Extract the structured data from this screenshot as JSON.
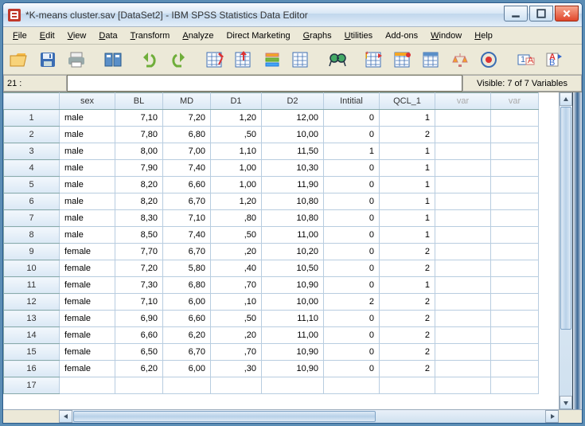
{
  "window": {
    "title": "*K-means cluster.sav [DataSet2] - IBM SPSS Statistics Data Editor"
  },
  "menu": {
    "file": "File",
    "edit": "Edit",
    "view": "View",
    "data": "Data",
    "transform": "Transform",
    "analyze": "Analyze",
    "direct": "Direct Marketing",
    "graphs": "Graphs",
    "utilities": "Utilities",
    "addons": "Add-ons",
    "window": "Window",
    "help": "Help"
  },
  "status": {
    "row_label": "21 :",
    "visible": "Visible: 7 of 7 Variables"
  },
  "columns": [
    "sex",
    "BL",
    "MD",
    "D1",
    "D2",
    "Intitial",
    "QCL_1"
  ],
  "varcols": [
    "var",
    "var"
  ],
  "rows": [
    {
      "n": "1",
      "sex": "male",
      "BL": "7,10",
      "MD": "7,20",
      "D1": "1,20",
      "D2": "12,00",
      "Intitial": "0",
      "QCL_1": "1"
    },
    {
      "n": "2",
      "sex": "male",
      "BL": "7,80",
      "MD": "6,80",
      "D1": ",50",
      "D2": "10,00",
      "Intitial": "0",
      "QCL_1": "2"
    },
    {
      "n": "3",
      "sex": "male",
      "BL": "8,00",
      "MD": "7,00",
      "D1": "1,10",
      "D2": "11,50",
      "Intitial": "1",
      "QCL_1": "1"
    },
    {
      "n": "4",
      "sex": "male",
      "BL": "7,90",
      "MD": "7,40",
      "D1": "1,00",
      "D2": "10,30",
      "Intitial": "0",
      "QCL_1": "1"
    },
    {
      "n": "5",
      "sex": "male",
      "BL": "8,20",
      "MD": "6,60",
      "D1": "1,00",
      "D2": "11,90",
      "Intitial": "0",
      "QCL_1": "1"
    },
    {
      "n": "6",
      "sex": "male",
      "BL": "8,20",
      "MD": "6,70",
      "D1": "1,20",
      "D2": "10,80",
      "Intitial": "0",
      "QCL_1": "1"
    },
    {
      "n": "7",
      "sex": "male",
      "BL": "8,30",
      "MD": "7,10",
      "D1": ",80",
      "D2": "10,80",
      "Intitial": "0",
      "QCL_1": "1"
    },
    {
      "n": "8",
      "sex": "male",
      "BL": "8,50",
      "MD": "7,40",
      "D1": ",50",
      "D2": "11,00",
      "Intitial": "0",
      "QCL_1": "1"
    },
    {
      "n": "9",
      "sex": "female",
      "BL": "7,70",
      "MD": "6,70",
      "D1": ",20",
      "D2": "10,20",
      "Intitial": "0",
      "QCL_1": "2"
    },
    {
      "n": "10",
      "sex": "female",
      "BL": "7,20",
      "MD": "5,80",
      "D1": ",40",
      "D2": "10,50",
      "Intitial": "0",
      "QCL_1": "2"
    },
    {
      "n": "11",
      "sex": "female",
      "BL": "7,30",
      "MD": "6,80",
      "D1": ",70",
      "D2": "10,90",
      "Intitial": "0",
      "QCL_1": "1"
    },
    {
      "n": "12",
      "sex": "female",
      "BL": "7,10",
      "MD": "6,00",
      "D1": ",10",
      "D2": "10,00",
      "Intitial": "2",
      "QCL_1": "2"
    },
    {
      "n": "13",
      "sex": "female",
      "BL": "6,90",
      "MD": "6,60",
      "D1": ",50",
      "D2": "11,10",
      "Intitial": "0",
      "QCL_1": "2"
    },
    {
      "n": "14",
      "sex": "female",
      "BL": "6,60",
      "MD": "6,20",
      "D1": ",20",
      "D2": "11,00",
      "Intitial": "0",
      "QCL_1": "2"
    },
    {
      "n": "15",
      "sex": "female",
      "BL": "6,50",
      "MD": "6,70",
      "D1": ",70",
      "D2": "10,90",
      "Intitial": "0",
      "QCL_1": "2"
    },
    {
      "n": "16",
      "sex": "female",
      "BL": "6,20",
      "MD": "6,00",
      "D1": ",30",
      "D2": "10,90",
      "Intitial": "0",
      "QCL_1": "2"
    }
  ],
  "empty_row": "17",
  "toolbar_icons": [
    "open",
    "save",
    "print",
    "recent",
    "undo",
    "redo",
    "goto-case",
    "goto-var",
    "variables",
    "run",
    "find",
    "insert-case",
    "insert-var",
    "split",
    "weight",
    "select",
    "value-labels",
    "spell"
  ]
}
